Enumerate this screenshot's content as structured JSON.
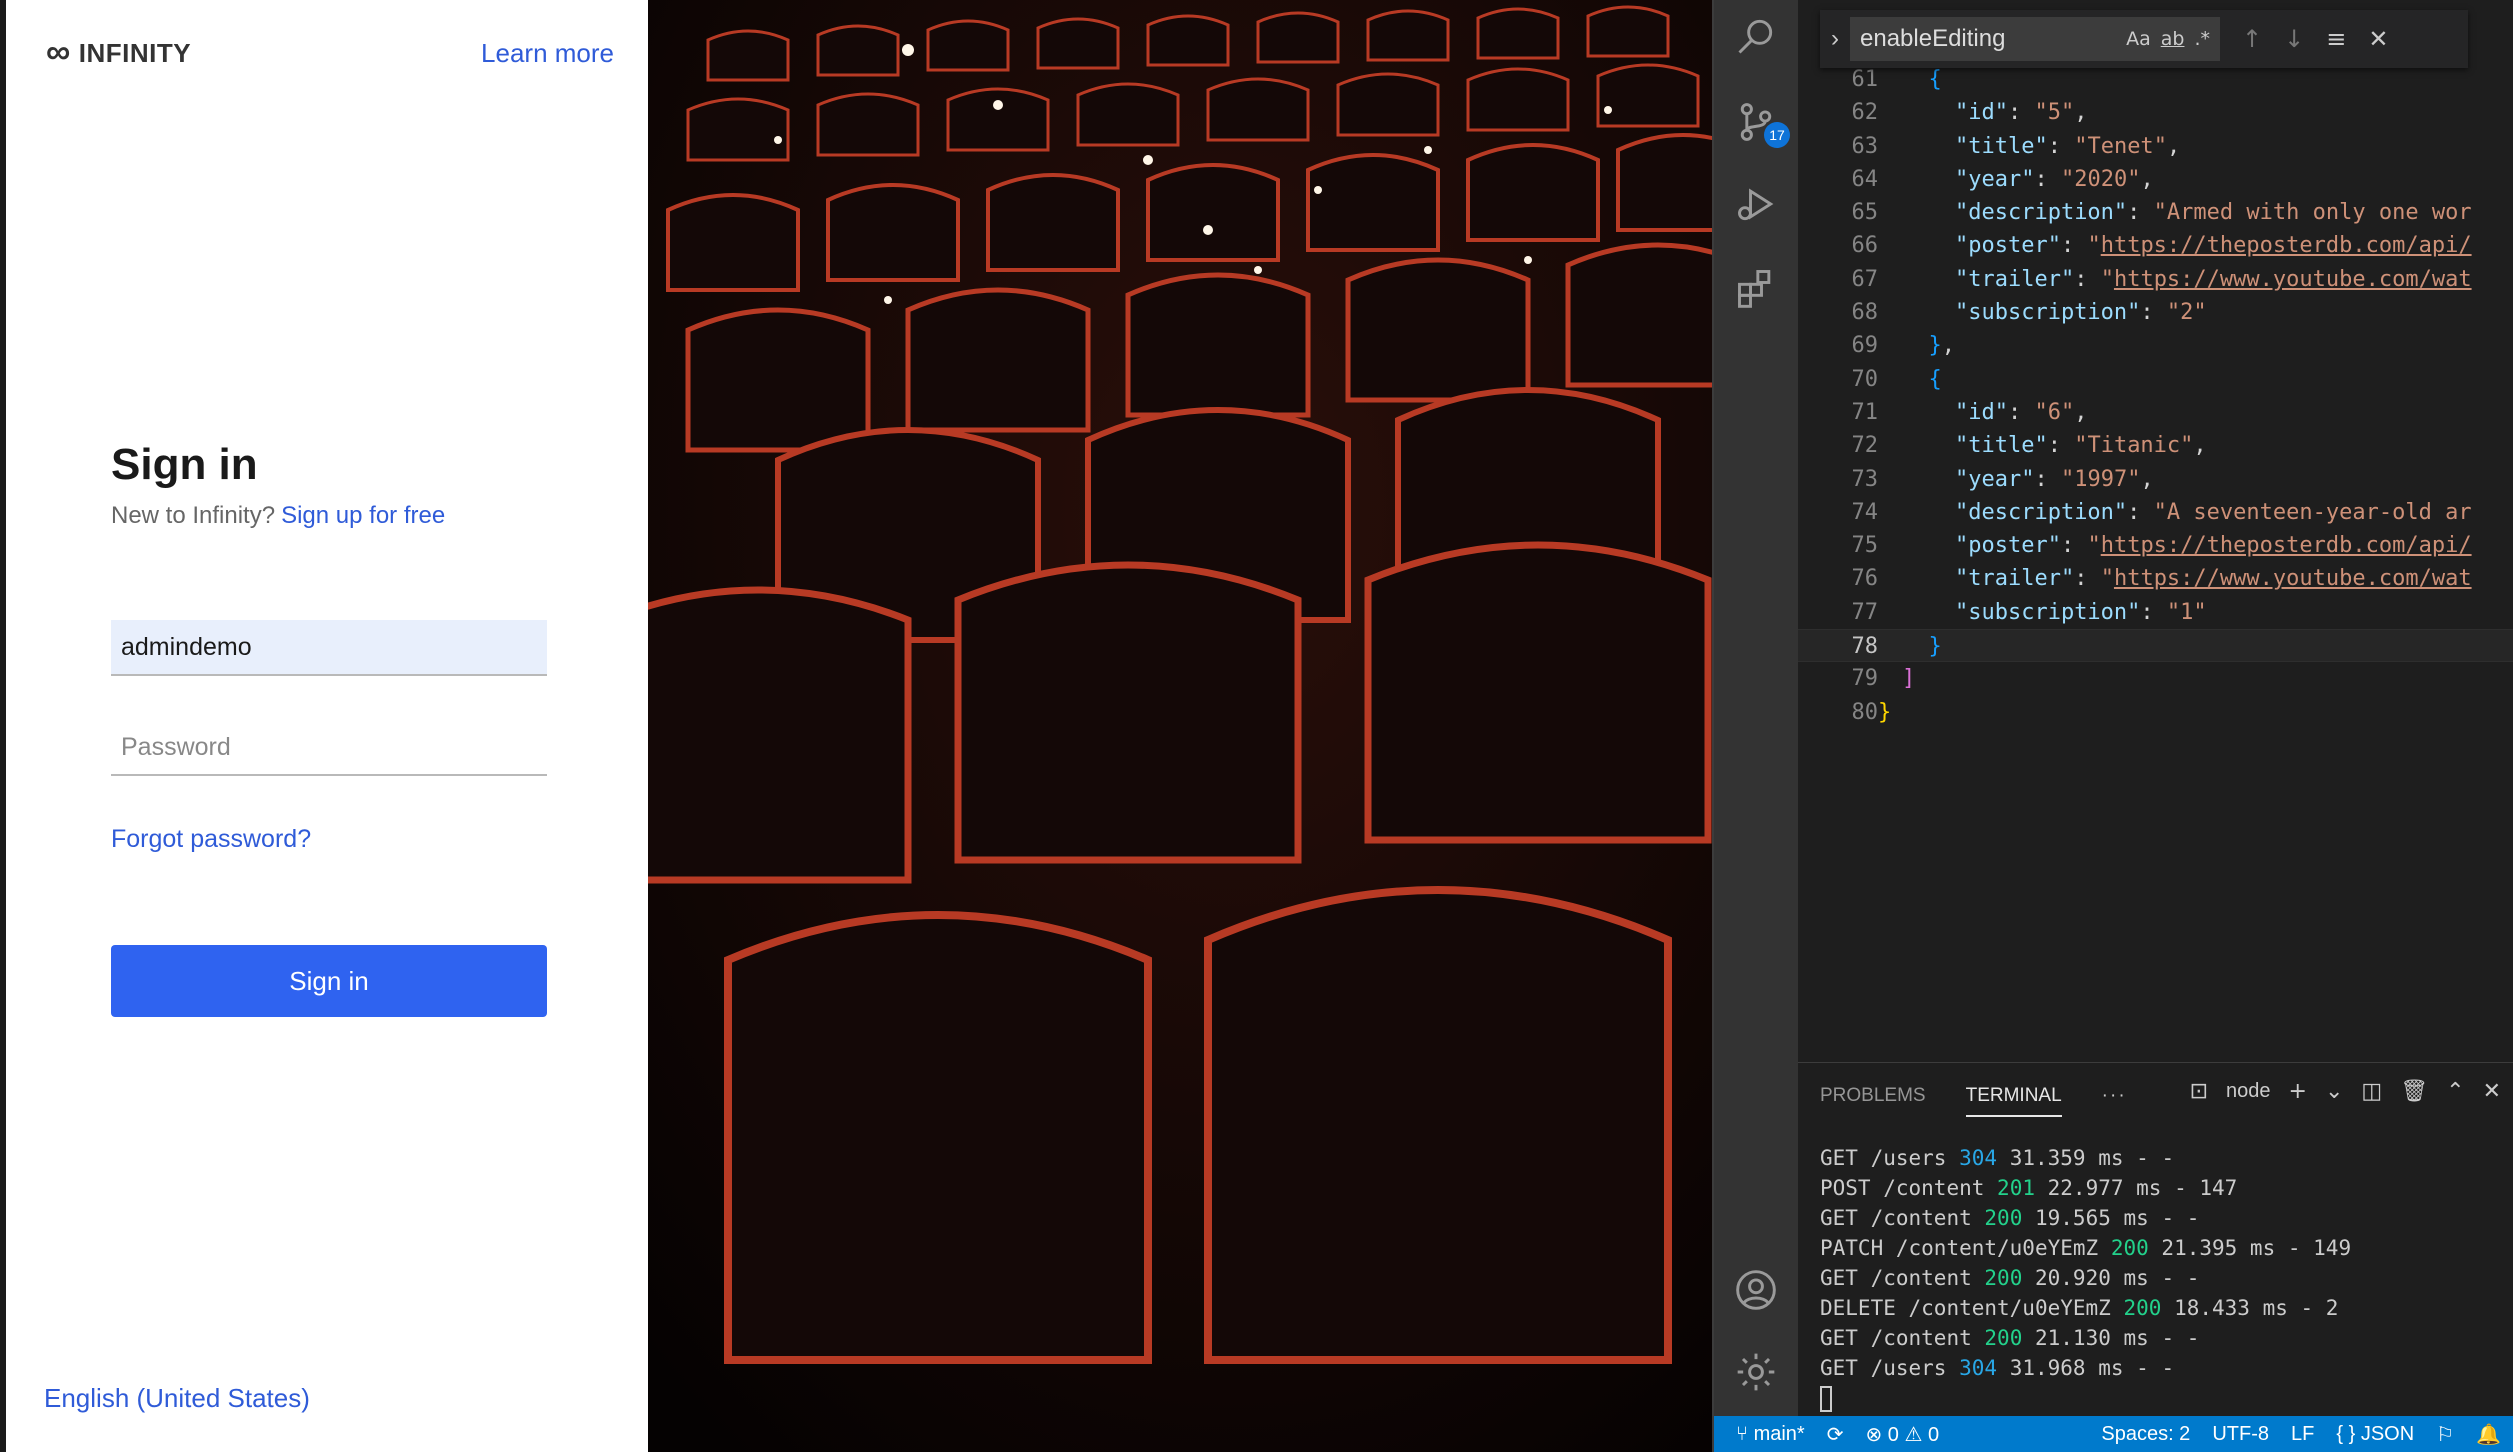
{
  "login": {
    "brand": "INFINITY",
    "brand_mark": "∞",
    "learn_more": "Learn more",
    "title": "Sign in",
    "new_to": "New to Infinity?",
    "signup": "Sign up for free",
    "username_value": "admindemo",
    "password_placeholder": "Password",
    "forgot": "Forgot password?",
    "submit": "Sign in",
    "language": "English (United States)",
    "accent": "#2f63f0"
  },
  "vscode": {
    "activity_badge": "17",
    "find": {
      "query": "enableEditing",
      "match_case": "Aa",
      "whole_word": "ab",
      "regex": ".*"
    },
    "editor": {
      "line_numbers": [
        "61",
        "62",
        "63",
        "64",
        "65",
        "66",
        "67",
        "68",
        "69",
        "70",
        "71",
        "72",
        "73",
        "74",
        "75",
        "76",
        "77",
        "78",
        "79",
        "80"
      ],
      "current_line": "78",
      "item5": {
        "id": "5",
        "title": "Tenet",
        "year": "2020",
        "description": "Armed with only one wor",
        "poster": "https://theposterdb.com/api/",
        "trailer": "https://www.youtube.com/wat",
        "subscription": "2"
      },
      "item6": {
        "id": "6",
        "title": "Titanic",
        "year": "1997",
        "description": "A seventeen-year-old ar",
        "poster": "https://theposterdb.com/api/",
        "trailer": "https://www.youtube.com/wat",
        "subscription": "1"
      }
    },
    "panel": {
      "tab_problems": "PROBLEMS",
      "tab_terminal": "TERMINAL",
      "tab_more": "···",
      "shell": "node",
      "log": [
        {
          "method": "GET",
          "path": "/users",
          "status": "304",
          "time": "31.359 ms",
          "size": "- -"
        },
        {
          "method": "POST",
          "path": "/content",
          "status": "201",
          "time": "22.977 ms",
          "size": "- 147"
        },
        {
          "method": "GET",
          "path": "/content",
          "status": "200",
          "time": "19.565 ms",
          "size": "- -"
        },
        {
          "method": "PATCH",
          "path": "/content/u0eYEmZ",
          "status": "200",
          "time": "21.395 ms",
          "size": "- 149"
        },
        {
          "method": "GET",
          "path": "/content",
          "status": "200",
          "time": "20.920 ms",
          "size": "- -"
        },
        {
          "method": "DELETE",
          "path": "/content/u0eYEmZ",
          "status": "200",
          "time": "18.433 ms",
          "size": "- 2"
        },
        {
          "method": "GET",
          "path": "/content",
          "status": "200",
          "time": "21.130 ms",
          "size": "- -"
        },
        {
          "method": "GET",
          "path": "/users",
          "status": "304",
          "time": "31.968 ms",
          "size": "- -"
        }
      ]
    },
    "status": {
      "branch": "main*",
      "errors": "0",
      "warnings": "0",
      "spaces": "Spaces: 2",
      "encoding": "UTF-8",
      "eol": "LF",
      "language": "JSON",
      "color": "#007acc"
    }
  }
}
